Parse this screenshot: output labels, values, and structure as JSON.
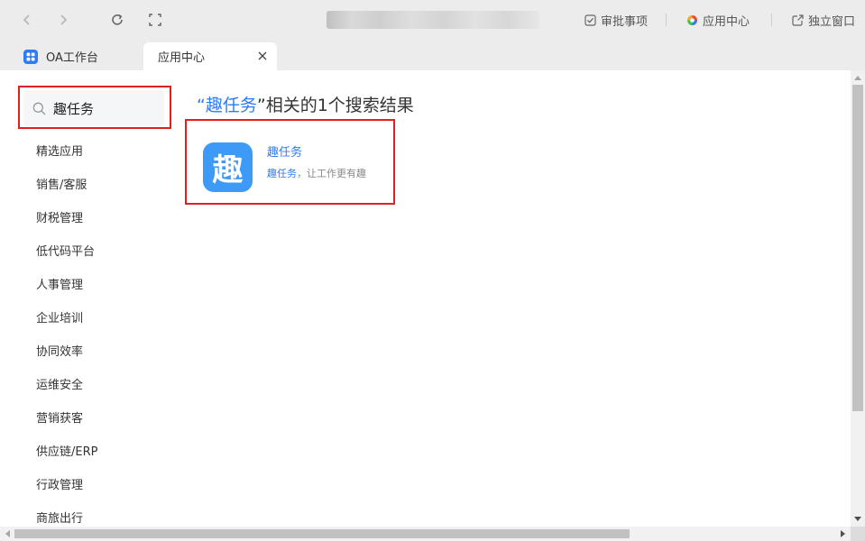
{
  "toolbar": {
    "approve_label": "审批事项",
    "app_center_label": "应用中心",
    "standalone_label": "独立窗口"
  },
  "tabs": [
    {
      "label": "OA工作台",
      "icon": "grid-icon"
    },
    {
      "label": "应用中心",
      "active": true
    }
  ],
  "search": {
    "value": "趣任务",
    "placeholder": ""
  },
  "categories": [
    "精选应用",
    "销售/客服",
    "财税管理",
    "低代码平台",
    "人事管理",
    "企业培训",
    "协同效率",
    "运维安全",
    "营销获客",
    "供应链/ERP",
    "行政管理",
    "商旅出行"
  ],
  "result": {
    "quote_open": "“",
    "keyword": "趣任务",
    "quote_close": "”",
    "suffix": "相关的1个搜索结果"
  },
  "app": {
    "icon_char": "趣",
    "name": "趣任务",
    "desc_highlight": "趣任务",
    "desc_rest": "，让工作更有趣"
  },
  "colors": {
    "accent": "#2b7cf6",
    "highlight_box": "#e02020",
    "app_icon_bg": "#3d9bf7"
  }
}
